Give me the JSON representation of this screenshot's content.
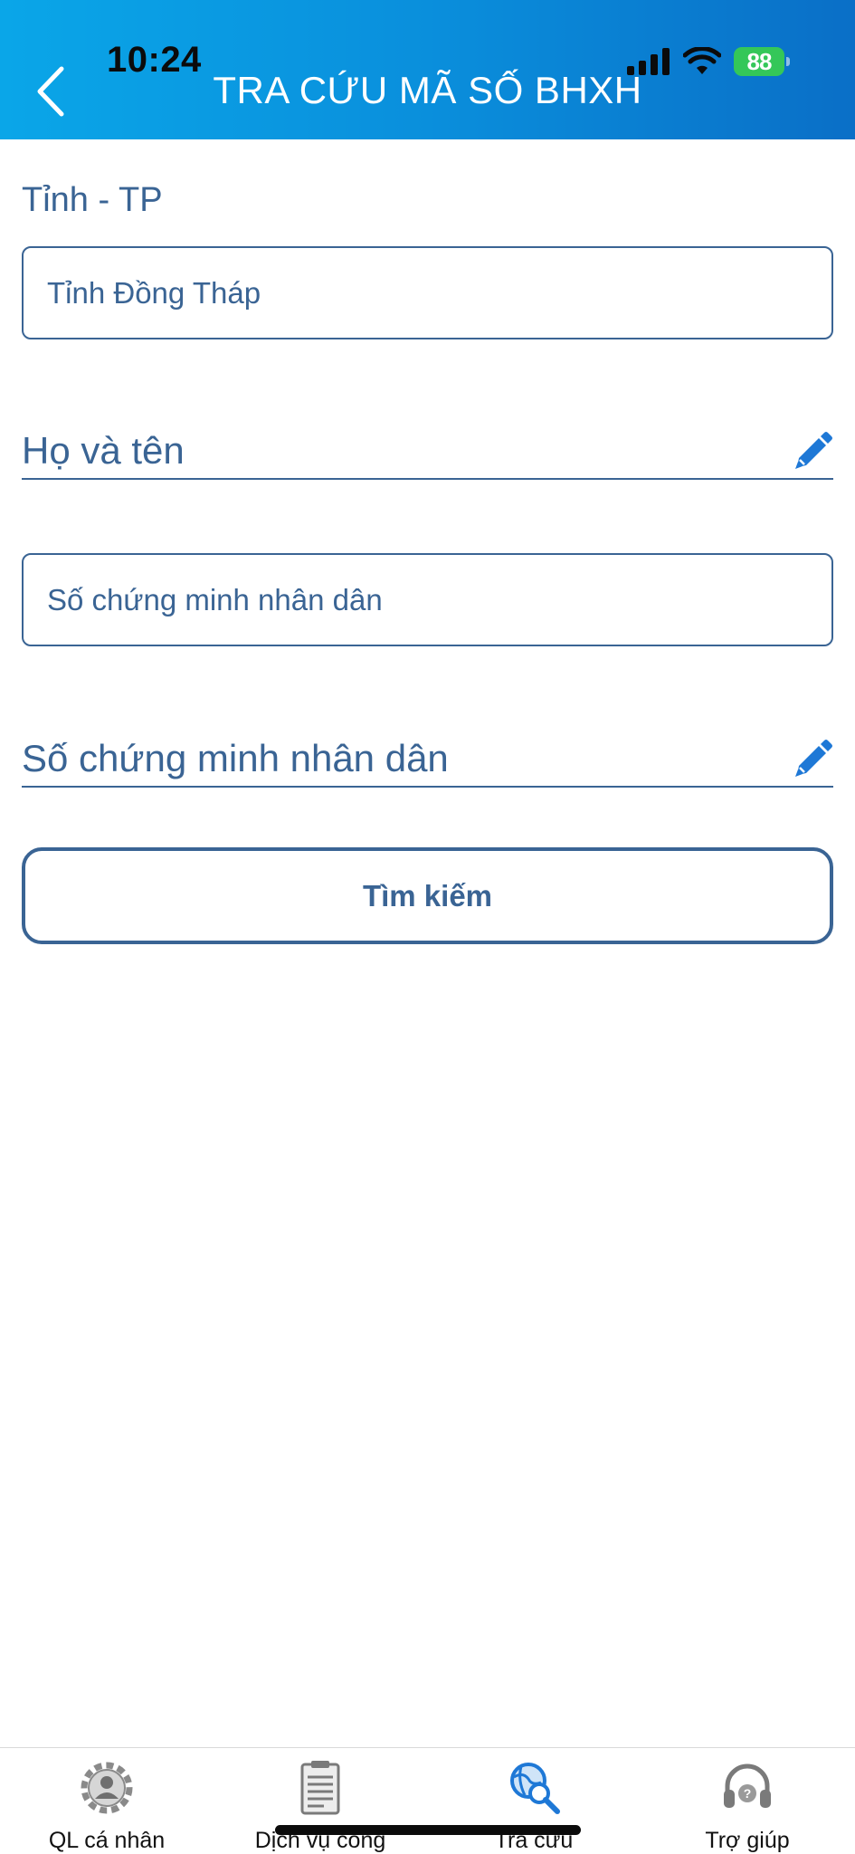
{
  "status_bar": {
    "time": "10:24",
    "battery": "88"
  },
  "header": {
    "title": "TRA CỨU MÃ SỐ BHXH",
    "back_icon": "chevron-left-icon"
  },
  "form": {
    "province_label": "Tỉnh - TP",
    "province_value": "Tỉnh Đồng Tháp",
    "name_placeholder": "Họ và tên",
    "idcard_box_placeholder": "Số chứng minh nhân dân",
    "idcard_placeholder": "Số chứng minh nhân dân",
    "search_label": "Tìm kiếm"
  },
  "bottom_nav": {
    "items": [
      {
        "label": "QL cá nhân",
        "icon": "gear-person-icon",
        "active": false
      },
      {
        "label": "Dịch vụ công",
        "icon": "document-icon",
        "active": false
      },
      {
        "label": "Tra cứu",
        "icon": "globe-search-icon",
        "active": true
      },
      {
        "label": "Trợ giúp",
        "icon": "headset-icon",
        "active": false
      }
    ]
  },
  "colors": {
    "header_start": "#0aa6e8",
    "header_end": "#0a6fc7",
    "primary_text": "#3a6494",
    "edit_icon": "#1e78d6",
    "active_nav": "#1e78d6",
    "inactive_nav": "#8a8a8a"
  }
}
